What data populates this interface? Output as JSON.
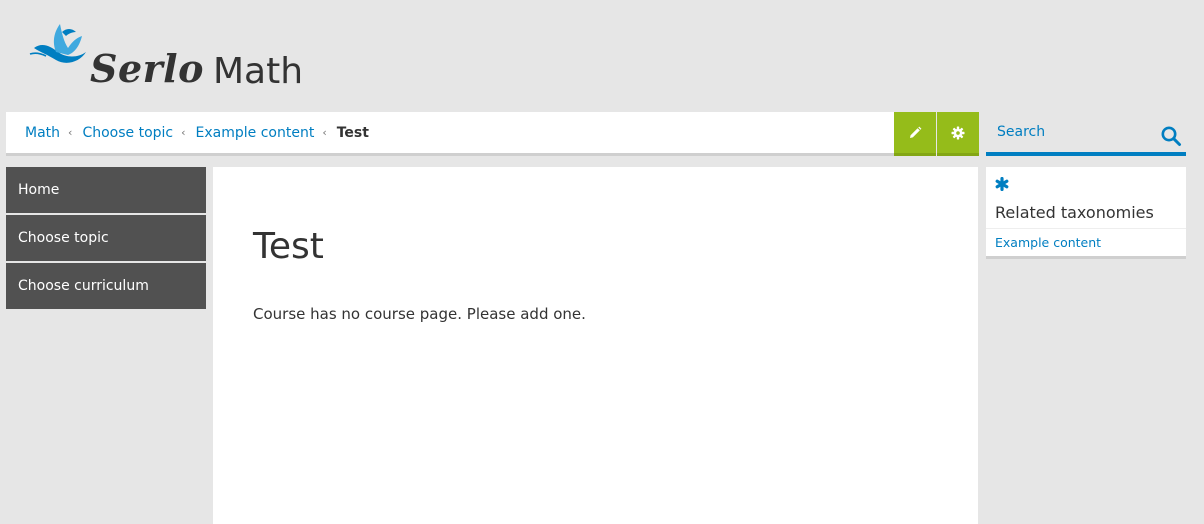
{
  "header": {
    "logo_name": "Serlo",
    "subject": "Math"
  },
  "breadcrumb": {
    "items": [
      "Math",
      "Choose topic",
      "Example content"
    ],
    "current": "Test",
    "separator": "‹"
  },
  "toolbar": {
    "edit_icon": "pencil-icon",
    "settings_icon": "gear-icon"
  },
  "search": {
    "placeholder": "Search",
    "value": ""
  },
  "sidebar": {
    "items": [
      {
        "label": "Home"
      },
      {
        "label": "Choose topic"
      },
      {
        "label": "Choose curriculum"
      }
    ]
  },
  "main": {
    "title": "Test",
    "text": "Course has no course page. Please add one."
  },
  "related": {
    "icon": "asterisk-icon",
    "title": "Related taxonomies",
    "links": [
      "Example content"
    ]
  },
  "colors": {
    "accent_blue": "#007ec1",
    "accent_green": "#95bc1a",
    "sidebar_bg": "#515151",
    "page_bg": "#e6e6e6"
  }
}
